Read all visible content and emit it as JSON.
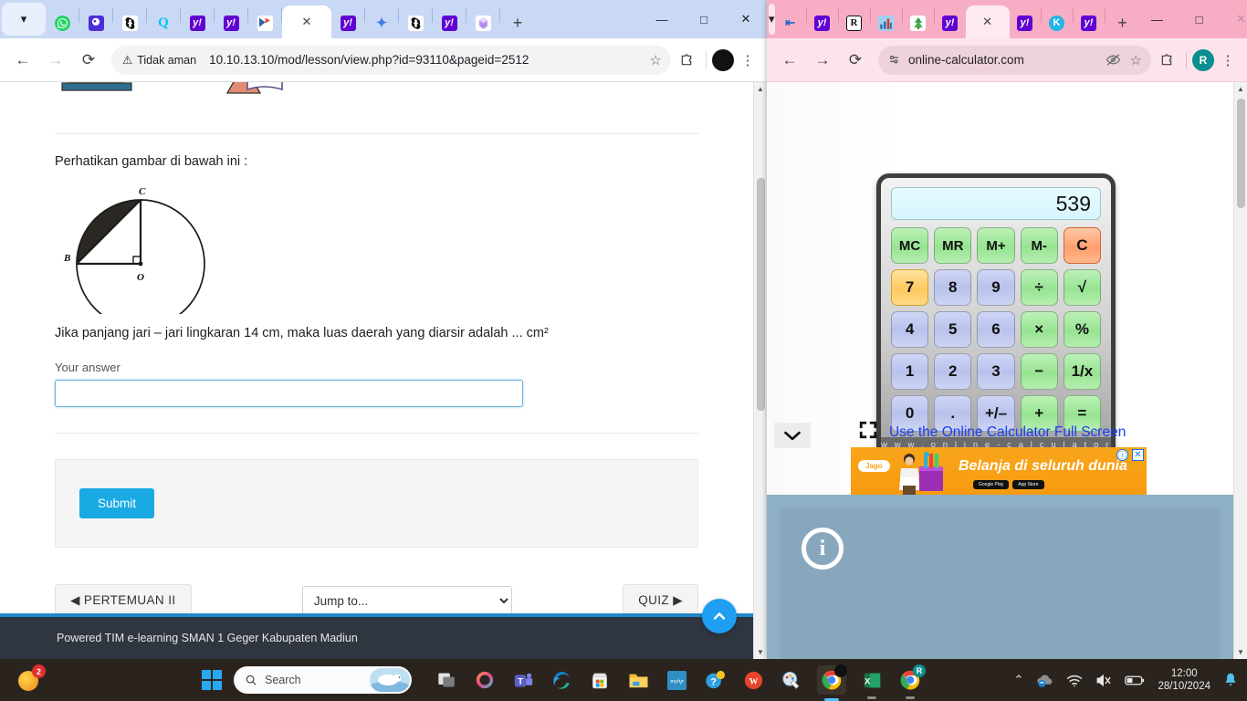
{
  "left_browser": {
    "tab_list_icon": "chevron-down-icon",
    "tabs": [
      {
        "name": "whatsapp",
        "glyph": "",
        "bg": "#25D366"
      },
      {
        "name": "quizizz-purple",
        "glyph": "",
        "bg": "#6d4fe0"
      },
      {
        "name": "chatgpt",
        "glyph": "",
        "bg": "#ffffff"
      },
      {
        "name": "quizizz-q",
        "glyph": "Q",
        "bg": "#00c2ff"
      },
      {
        "name": "yahoo-1",
        "glyph": "y!",
        "bg": "#6001d2"
      },
      {
        "name": "yahoo-2",
        "glyph": "y!",
        "bg": "#6001d2"
      },
      {
        "name": "kahoot",
        "glyph": "",
        "bg": "#ffffff"
      },
      {
        "name": "active-tab",
        "glyph": "×",
        "bg": "#ffffff",
        "active": true
      },
      {
        "name": "yahoo-3",
        "glyph": "y!",
        "bg": "#6001d2"
      },
      {
        "name": "copilot-spark",
        "glyph": "✦",
        "bg": "#3f7be0"
      },
      {
        "name": "chatgpt-2",
        "glyph": "",
        "bg": "#ffffff"
      },
      {
        "name": "yahoo-4",
        "glyph": "y!",
        "bg": "#6001d2"
      },
      {
        "name": "gem-icon",
        "glyph": "",
        "bg": "#ffffff"
      }
    ],
    "new_tab_label": "+",
    "window_controls": {
      "minimize": "—",
      "maximize": "□",
      "close": "✕"
    },
    "toolbar": {
      "back": "←",
      "forward": "→",
      "reload": "⟳",
      "security_warning": "Tidak aman",
      "url": "10.10.13.10/mod/lesson/view.php?id=93110&pageid=2512",
      "bookmark": "☆",
      "extensions": "puzzle-piece-icon",
      "menu": "⋮"
    }
  },
  "lesson_page": {
    "prompt": "Perhatikan gambar di bawah ini :",
    "figure": {
      "labels": {
        "center": "O",
        "left": "B",
        "top": "C"
      },
      "description": "circle-with-shaded-segment"
    },
    "question": "Jika panjang jari – jari lingkaran 14 cm, maka luas daerah yang diarsir adalah ... cm²",
    "answer_label": "Your answer",
    "answer_value": "",
    "answer_placeholder": "",
    "submit_label": "Submit",
    "prev_label": "◀ PERTEMUAN II",
    "jump_label": "Jump to...",
    "jump_options": [
      "Jump to..."
    ],
    "next_label": "QUIZ ▶",
    "footer": "Powered TIM e-learning SMAN 1 Geger Kabupaten Madiun",
    "scroll_top_icon": "chevron-up-icon"
  },
  "right_browser": {
    "tabs": [
      {
        "name": "list-icon",
        "glyph": "⇥",
        "bg": "#eef3fb"
      },
      {
        "name": "yahoo-a",
        "glyph": "y!",
        "bg": "#6001d2"
      },
      {
        "name": "rakuten-r",
        "glyph": "R",
        "bg": "#ffffff"
      },
      {
        "name": "fm-chart",
        "glyph": "",
        "bg": "#7fc4f0"
      },
      {
        "name": "tree-icon",
        "glyph": "",
        "bg": "#ffffff"
      },
      {
        "name": "yahoo-b",
        "glyph": "y!",
        "bg": "#6001d2"
      },
      {
        "name": "active-tab",
        "glyph": "×",
        "bg": "#fdeaf0",
        "active": true
      },
      {
        "name": "yahoo-c",
        "glyph": "y!",
        "bg": "#6001d2"
      },
      {
        "name": "kahoot-k",
        "glyph": "K",
        "bg": "#21b6e8"
      },
      {
        "name": "yahoo-d",
        "glyph": "y!",
        "bg": "#6001d2"
      }
    ],
    "new_tab_label": "+",
    "window_controls": {
      "minimize": "—",
      "maximize": "□",
      "close": "✕"
    },
    "toolbar": {
      "back": "←",
      "forward": "→",
      "reload": "⟳",
      "url": "online-calculator.com",
      "site_settings": "tune-icon",
      "incognito_eye": "eye-slash-icon",
      "bookmark": "☆",
      "extensions": "puzzle-piece-icon",
      "profile_initial": "R",
      "menu": "⋮"
    }
  },
  "calculator": {
    "display": "539",
    "brand": "w w w . o n l i n e - c a l c u l a t o r . c o m",
    "keys": [
      {
        "label": "MC",
        "type": "mem"
      },
      {
        "label": "MR",
        "type": "mem"
      },
      {
        "label": "M+",
        "type": "mem"
      },
      {
        "label": "M-",
        "type": "mem"
      },
      {
        "label": "C",
        "type": "clr"
      },
      {
        "label": "7",
        "type": "hot"
      },
      {
        "label": "8",
        "type": "num"
      },
      {
        "label": "9",
        "type": "num"
      },
      {
        "label": "÷",
        "type": "op"
      },
      {
        "label": "√",
        "type": "op"
      },
      {
        "label": "4",
        "type": "num"
      },
      {
        "label": "5",
        "type": "num"
      },
      {
        "label": "6",
        "type": "num"
      },
      {
        "label": "×",
        "type": "op"
      },
      {
        "label": "%",
        "type": "op"
      },
      {
        "label": "1",
        "type": "num"
      },
      {
        "label": "2",
        "type": "num"
      },
      {
        "label": "3",
        "type": "num"
      },
      {
        "label": "−",
        "type": "op"
      },
      {
        "label": "1/x",
        "type": "op"
      },
      {
        "label": "0",
        "type": "num"
      },
      {
        "label": ".",
        "type": "num"
      },
      {
        "label": "+/–",
        "type": "num"
      },
      {
        "label": "+",
        "type": "op"
      },
      {
        "label": "=",
        "type": "op"
      }
    ],
    "fullscreen_link": "Use the Online Calculator Full Screen",
    "fullscreen_icon": "expand-icon"
  },
  "advertisement": {
    "brand": "Jago",
    "headline": "Belanja di seluruh dunia",
    "store_badges": [
      "Google Play",
      "App Store"
    ],
    "info_icon": "ⓘ",
    "close_icon": "✕"
  },
  "taskbar": {
    "notification_badge": "2",
    "start_icon": "windows-icon",
    "search_placeholder": "Search",
    "search_icon": "search-icon",
    "apps": [
      {
        "name": "task-view",
        "glyph": ""
      },
      {
        "name": "copilot",
        "glyph": ""
      },
      {
        "name": "microsoft-teams",
        "glyph": "T"
      },
      {
        "name": "microsoft-edge",
        "glyph": ""
      },
      {
        "name": "microsoft-store",
        "glyph": ""
      },
      {
        "name": "file-explorer",
        "glyph": ""
      },
      {
        "name": "my-hp",
        "glyph": "myhp"
      },
      {
        "name": "help-support",
        "glyph": "?"
      },
      {
        "name": "wps-office",
        "glyph": "W"
      },
      {
        "name": "paint",
        "glyph": ""
      },
      {
        "name": "google-chrome-active",
        "glyph": ""
      },
      {
        "name": "microsoft-excel",
        "glyph": "X"
      },
      {
        "name": "google-chrome-profile-r",
        "glyph": "R"
      }
    ],
    "tray": {
      "overflow": "⌃",
      "network_icon": "wifi-icon",
      "volume_icon": "volume-muted-icon",
      "battery_icon": "battery-icon",
      "time": "12:00",
      "date": "28/10/2024",
      "bell_icon": "bell-icon"
    }
  }
}
